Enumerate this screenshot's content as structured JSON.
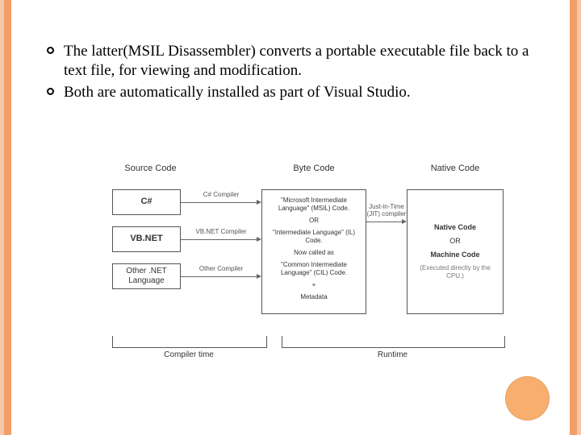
{
  "bullets": [
    "The latter(MSIL Disassembler) converts a portable executable file back to a text file, for viewing and modification.",
    "Both are automatically installed as part of Visual Studio."
  ],
  "diagram": {
    "columns": {
      "source": "Source Code",
      "byte": "Byte Code",
      "native": "Native Code"
    },
    "sources": [
      "C#",
      "VB.NET",
      "Other .NET Language"
    ],
    "compilers": [
      "C# Compiler",
      "VB.NET Compiler",
      "Other Compiler"
    ],
    "jit": "Just-in-Time (JIT) compiler",
    "byte_box": {
      "line1": "\"Microsoft Intermediate Language\" (MSIL) Code.",
      "line2": "OR",
      "line3": "\"Intermediate Language\" (IL) Code.",
      "line4": "Now called as",
      "line5": "\"Common Intermediate Language\" (CIL) Code.",
      "line6": "+",
      "line7": "Metadata"
    },
    "native_box": {
      "line1": "Native Code",
      "line2": "OR",
      "line3": "Machine Code",
      "line4": "(Executed directly by the CPU.)"
    },
    "timeline": {
      "compile": "Compiler time",
      "runtime": "Runtime"
    }
  }
}
